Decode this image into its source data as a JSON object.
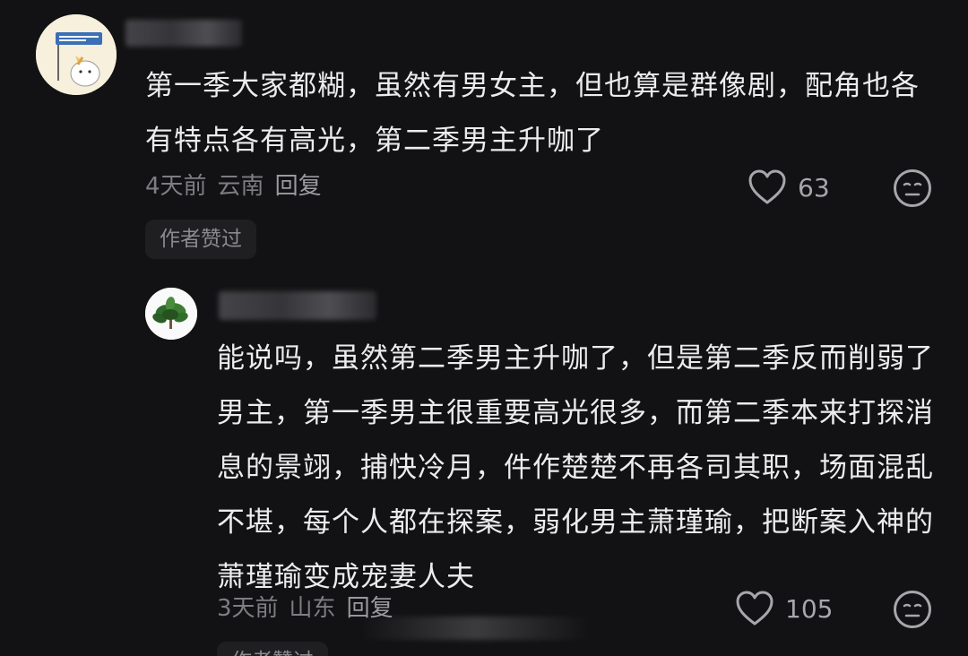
{
  "comments": [
    {
      "avatar_icon": "cartoon-cat-avatar",
      "text": "第一季大家都糊，虽然有男女主，但也算是群像剧，配角也各有特点各有高光，第二季男主升咖了",
      "time": "4天前",
      "location": "云南",
      "reply_label": "回复",
      "likes": "63",
      "badge": "作者赞过"
    },
    {
      "avatar_icon": "green-plant-avatar",
      "text": "能说吗，虽然第二季男主升咖了，但是第二季反而削弱了男主，第一季男主很重要高光很多，而第二季本来打探消息的景翊，捕快冷月，件作楚楚不再各司其职，场面混乱不堪，每个人都在探案，弱化男主萧瑾瑜，把断案入神的萧瑾瑜变成宠妻人夫",
      "time": "3天前",
      "location": "山东",
      "reply_label": "回复",
      "likes": "105",
      "badge": "作者赞过"
    }
  ],
  "colors": {
    "background": "#121214",
    "text": "#ececee",
    "meta": "#7d7d82",
    "badge_bg": "#1f1f22"
  }
}
